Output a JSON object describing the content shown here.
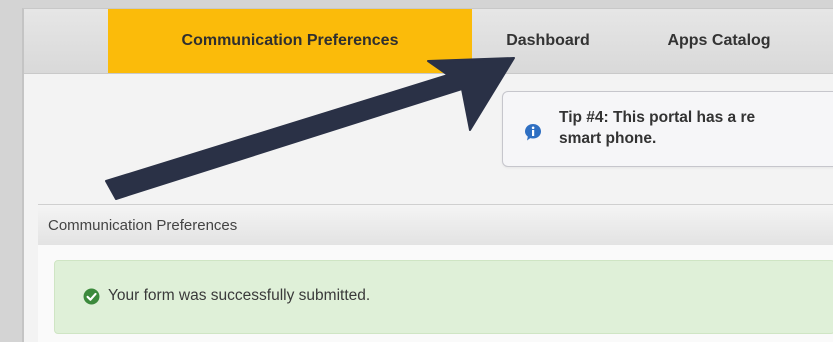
{
  "nav": {
    "tabs": [
      {
        "label": "Communication Preferences",
        "active": true
      },
      {
        "label": "Dashboard",
        "active": false
      },
      {
        "label": "Apps Catalog",
        "active": false
      }
    ]
  },
  "tip": {
    "icon": "info-icon",
    "text": "Tip #4: This portal has a re\nsmart phone."
  },
  "panel": {
    "heading": "Communication Preferences",
    "alert": {
      "icon": "check-circle-icon",
      "text": "Your form was successfully submitted."
    }
  },
  "annotation": {
    "type": "arrow",
    "color": "#2a3146"
  },
  "colors": {
    "active_tab": "#fbbb0a",
    "success_bg": "#dff0d8",
    "success_icon": "#3c8a3c",
    "info_icon": "#2f6fc2"
  }
}
